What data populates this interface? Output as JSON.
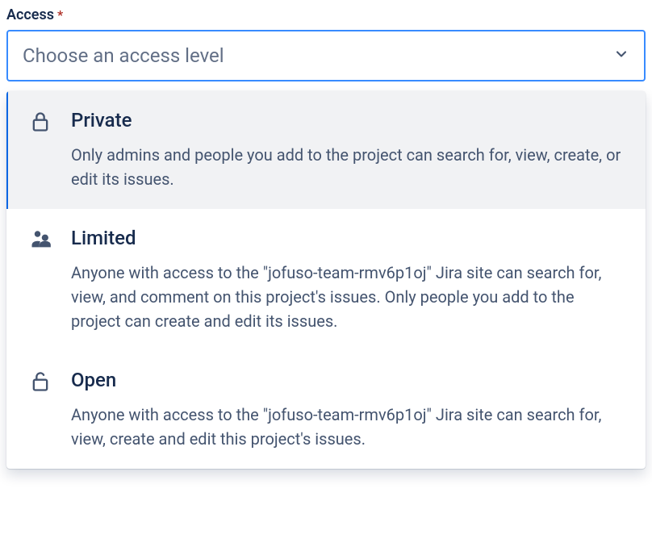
{
  "field": {
    "label": "Access",
    "required_marker": "*",
    "placeholder": "Choose an access level"
  },
  "options": [
    {
      "title": "Private",
      "description": "Only admins and people you add to the project can search for, view, create, or edit its issues."
    },
    {
      "title": "Limited",
      "description": "Anyone with access to the \"jofuso-team-rmv6p1oj\" Jira site can search for, view, and comment on this project's issues. Only people you add to the project can create and edit its issues."
    },
    {
      "title": "Open",
      "description": "Anyone with access to the \"jofuso-team-rmv6p1oj\" Jira site can search for, view, create and edit this project's issues."
    }
  ]
}
